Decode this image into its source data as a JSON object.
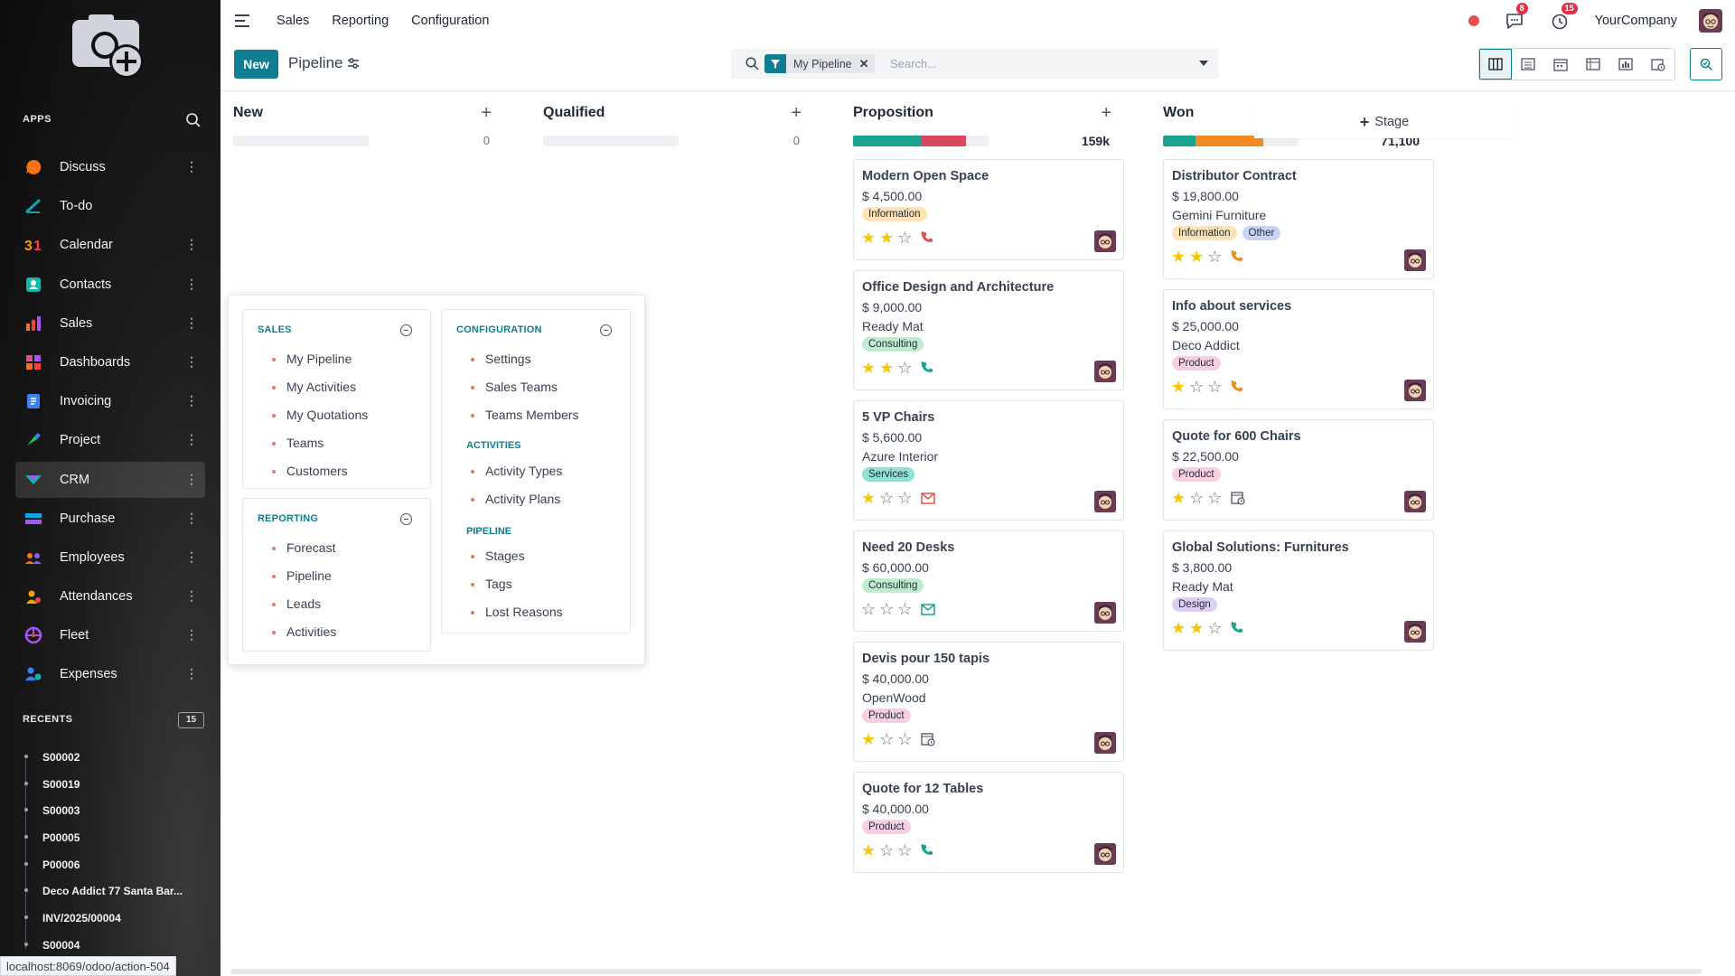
{
  "sidebar": {
    "apps_label": "APPS",
    "apps": [
      {
        "label": "Discuss",
        "icon": "discuss-icon",
        "color": "#f97316"
      },
      {
        "label": "To-do",
        "icon": "todo-icon",
        "color": "#0ea5b7"
      },
      {
        "label": "Calendar",
        "icon": "calendar-icon",
        "color": "#f59e0b"
      },
      {
        "label": "Contacts",
        "icon": "contacts-icon",
        "color": "#14b8a6"
      },
      {
        "label": "Sales",
        "icon": "sales-icon",
        "color": "#ef4444"
      },
      {
        "label": "Dashboards",
        "icon": "dashboards-icon",
        "color": "#ec4899"
      },
      {
        "label": "Invoicing",
        "icon": "invoicing-icon",
        "color": "#3b82f6"
      },
      {
        "label": "Project",
        "icon": "project-icon",
        "color": "#22c55e"
      },
      {
        "label": "CRM",
        "icon": "crm-icon",
        "color": "#14b8a6"
      },
      {
        "label": "Purchase",
        "icon": "purchase-icon",
        "color": "#0ea5e9"
      },
      {
        "label": "Employees",
        "icon": "employees-icon",
        "color": "#8b5cf6"
      },
      {
        "label": "Attendances",
        "icon": "attendances-icon",
        "color": "#f59e0b"
      },
      {
        "label": "Fleet",
        "icon": "fleet-icon",
        "color": "#a855f7"
      },
      {
        "label": "Expenses",
        "icon": "expenses-icon",
        "color": "#3b82f6"
      }
    ],
    "recents_label": "RECENTS",
    "recents_count": "15",
    "recents": [
      "S00002",
      "S00019",
      "S00003",
      "P00005",
      "P00006",
      "Deco Addict 77 Santa Bar...",
      "INV/2025/00004",
      "S00004"
    ],
    "status_url": "localhost:8069/odoo/action-504"
  },
  "topnav": {
    "links": [
      "Sales",
      "Reporting",
      "Configuration"
    ],
    "messages_badge": "8",
    "activities_badge": "15",
    "company": "YourCompany"
  },
  "control": {
    "new_label": "New",
    "title": "Pipeline",
    "facet": "My Pipeline",
    "search_placeholder": "Search..."
  },
  "kanban": {
    "columns": [
      {
        "name": "New",
        "total": "0"
      },
      {
        "name": "Qualified",
        "total": "0"
      },
      {
        "name": "Proposition",
        "total": "159k"
      },
      {
        "name": "Won",
        "total": "71,100"
      }
    ],
    "add_stage": "Stage",
    "cards": {
      "proposition": [
        {
          "title": "Modern Open Space",
          "revenue": "$ 4,500.00",
          "partner": "",
          "tags": [
            "Information"
          ],
          "stars": 2,
          "activity": "phone"
        },
        {
          "title": "Office Design and Architecture",
          "revenue": "$ 9,000.00",
          "partner": "Ready Mat",
          "tags": [
            "Consulting"
          ],
          "stars": 2,
          "activity": "phone"
        },
        {
          "title": "5 VP Chairs",
          "revenue": "$ 5,600.00",
          "partner": "Azure Interior",
          "tags": [
            "Services"
          ],
          "stars": 1,
          "activity": "email"
        },
        {
          "title": "Need 20 Desks",
          "revenue": "$ 60,000.00",
          "partner": "",
          "tags": [
            "Consulting"
          ],
          "stars": 0,
          "activity": "email"
        },
        {
          "title": "Devis pour 150 tapis",
          "revenue": "$ 40,000.00",
          "partner": "OpenWood",
          "tags": [
            "Product"
          ],
          "stars": 1,
          "activity": "calendar"
        },
        {
          "title": "Quote for 12 Tables",
          "revenue": "$ 40,000.00",
          "partner": "",
          "tags": [
            "Product"
          ],
          "stars": 1,
          "activity": "phone"
        }
      ],
      "won": [
        {
          "title": "Distributor Contract",
          "revenue": "$ 19,800.00",
          "partner": "Gemini Furniture",
          "tags": [
            "Information",
            "Other"
          ],
          "stars": 2,
          "activity": "phone"
        },
        {
          "title": "Info about services",
          "revenue": "$ 25,000.00",
          "partner": "Deco Addict",
          "tags": [
            "Product"
          ],
          "stars": 1,
          "activity": "phone"
        },
        {
          "title": "Quote for 600 Chairs",
          "revenue": "$ 22,500.00",
          "partner": "",
          "tags": [
            "Product"
          ],
          "stars": 1,
          "activity": "calendar"
        },
        {
          "title": "Global Solutions: Furnitures",
          "revenue": "$ 3,800.00",
          "partner": "Ready Mat",
          "tags": [
            "Design"
          ],
          "stars": 2,
          "activity": "phone"
        }
      ]
    },
    "tag_colors": {
      "Information": "#fde2b3",
      "Other": "#c9d4f4",
      "Consulting": "#bfeccf",
      "Services": "#8fe0d5",
      "Product": "#f8cfe0",
      "Design": "#dccdf3"
    }
  },
  "menu": {
    "sales": {
      "title": "SALES",
      "items": [
        "My Pipeline",
        "My Activities",
        "My Quotations",
        "Teams",
        "Customers"
      ]
    },
    "reporting": {
      "title": "REPORTING",
      "items": [
        "Forecast",
        "Pipeline",
        "Leads",
        "Activities"
      ]
    },
    "configuration": {
      "title": "CONFIGURATION",
      "items": [
        "Settings",
        "Sales Teams",
        "Teams Members"
      ],
      "activities_title": "ACTIVITIES",
      "activities_items": [
        "Activity Types",
        "Activity Plans"
      ],
      "pipeline_title": "PIPELINE",
      "pipeline_items": [
        "Stages",
        "Tags",
        "Lost Reasons"
      ]
    }
  }
}
